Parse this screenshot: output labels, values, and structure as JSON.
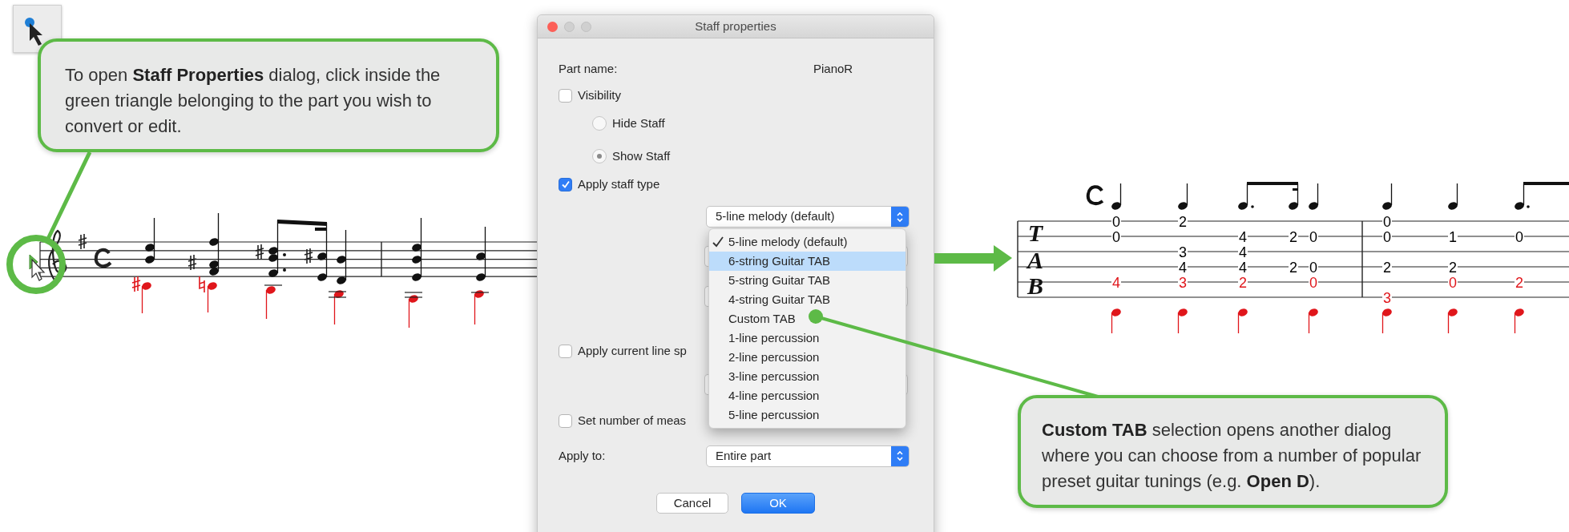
{
  "callouts": [
    {
      "text": "To open **Staff Properties** dialog, click inside the green triangle belonging to the part you wish to convert or edit."
    },
    {
      "text": "**Custom TAB** selection opens another dialog where you can choose from a number of popular preset guitar tunings (e.g. **Open D**)."
    }
  ],
  "dialog": {
    "title": "Staff properties",
    "part_name_label": "Part name:",
    "part_name": "PianoR",
    "controls": [
      {
        "kind": "checkbox",
        "label": "Visibility",
        "checked": false
      },
      {
        "kind": "radio",
        "label": "Hide Staff",
        "selected": false
      },
      {
        "kind": "radio",
        "label": "Show Staff",
        "selected": true
      },
      {
        "kind": "checkbox",
        "label": "Apply staff type",
        "checked": true
      },
      {
        "kind": "select",
        "value": "5-line melody (default)"
      },
      {
        "kind": "field"
      },
      {
        "kind": "field"
      },
      {
        "kind": "checkbox",
        "label": "Apply current line sp",
        "checked": false
      },
      {
        "kind": "field"
      },
      {
        "kind": "checkbox",
        "label": "Set number of meas",
        "checked": false
      },
      {
        "kind": "labeled_select",
        "label": "Apply to:",
        "value": "Entire part"
      }
    ],
    "menu": [
      {
        "label": "5-line melody (default)",
        "checked": true,
        "selected": false
      },
      {
        "label": "6-string Guitar TAB",
        "checked": false,
        "selected": true
      },
      {
        "label": "5-string Guitar TAB",
        "checked": false,
        "selected": false
      },
      {
        "label": "4-string Guitar TAB",
        "checked": false,
        "selected": false
      },
      {
        "label": "Custom TAB",
        "checked": false,
        "selected": false
      },
      {
        "label": "1-line percussion",
        "checked": false,
        "selected": false
      },
      {
        "label": "2-line percussion",
        "checked": false,
        "selected": false
      },
      {
        "label": "3-line percussion",
        "checked": false,
        "selected": false
      },
      {
        "label": "4-line percussion",
        "checked": false,
        "selected": false
      },
      {
        "label": "5-line percussion",
        "checked": false,
        "selected": false
      }
    ],
    "buttons": [
      {
        "label": "Cancel",
        "default": false
      },
      {
        "label": "OK",
        "default": true
      }
    ]
  },
  "tab": {
    "clef": [
      "T",
      "A",
      "B"
    ],
    "measures": [
      {
        "columns": [
          {
            "string_1": {
              "fret": "0",
              "color": "#000000"
            },
            "string_2": {
              "fret": "0",
              "color": "#000000"
            },
            "string_5": {
              "fret": "4",
              "color": "#e0161b"
            }
          },
          {
            "string_1": {
              "fret": "2",
              "color": "#000000"
            },
            "string_3": {
              "fret": "3",
              "color": "#000000"
            },
            "string_4": {
              "fret": "4",
              "color": "#000000"
            },
            "string_5": {
              "fret": "3",
              "color": "#e0161b"
            }
          },
          {
            "string_2": {
              "fret": "4",
              "color": "#000000"
            },
            "string_3": {
              "fret": "4",
              "color": "#000000"
            },
            "string_4": {
              "fret": "4",
              "color": "#000000"
            },
            "string_5": {
              "fret": "2",
              "color": "#e0161b"
            }
          },
          {
            "string_2": {
              "fret": "2",
              "color": "#000000"
            },
            "string_4": {
              "fret": "2",
              "color": "#000000"
            }
          },
          {
            "string_2": {
              "fret": "0",
              "color": "#000000"
            },
            "string_4": {
              "fret": "0",
              "color": "#000000"
            },
            "string_5": {
              "fret": "0",
              "color": "#e0161b"
            }
          }
        ]
      },
      {
        "columns": [
          {
            "string_1": {
              "fret": "0",
              "color": "#000000"
            },
            "string_2": {
              "fret": "0",
              "color": "#000000"
            },
            "string_4": {
              "fret": "2",
              "color": "#000000"
            },
            "string_6": {
              "fret": "3",
              "color": "#e0161b"
            }
          },
          {
            "string_2": {
              "fret": "1",
              "color": "#000000"
            },
            "string_4": {
              "fret": "2",
              "color": "#000000"
            },
            "string_5": {
              "fret": "0",
              "color": "#e0161b"
            }
          },
          {
            "string_2": {
              "fret": "0",
              "color": "#000000"
            },
            "string_5": {
              "fret": "2",
              "color": "#e0161b"
            }
          }
        ]
      }
    ]
  }
}
